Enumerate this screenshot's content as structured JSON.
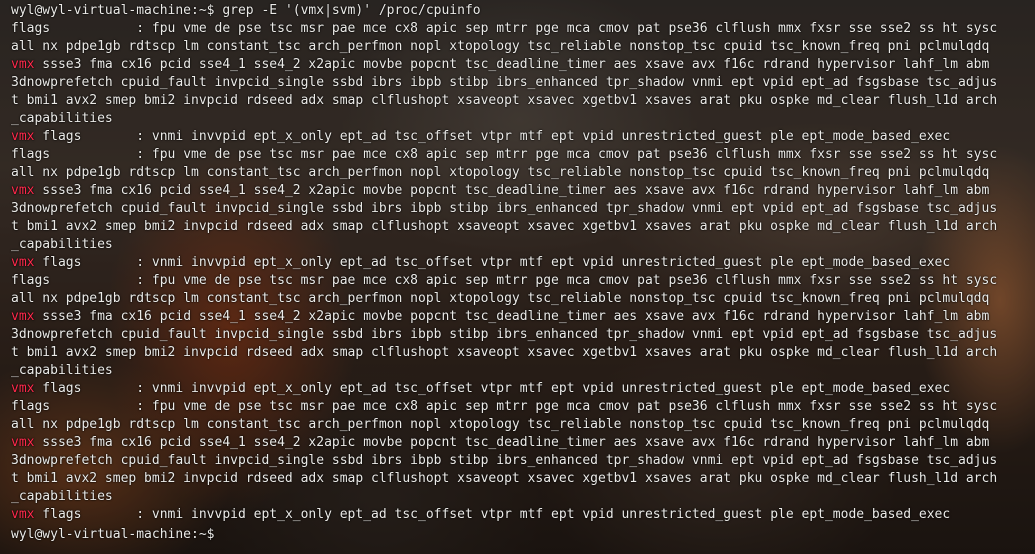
{
  "prompt": "wyl@wyl-virtual-machine:~$",
  "command": " grep -E '(vmx|svm)' /proc/cpuinfo",
  "match_token": "vmx",
  "highlight_color": "#ff2a4c",
  "blocks": [
    {
      "flags_label": "flags",
      "flags_rest": "           : fpu vme de pse tsc msr pae mce cx8 apic sep mtrr pge mca cmov pat pse36 clflush mmx fxsr sse sse2 ss ht sysc",
      "l2": "all nx pdpe1gb rdtscp lm constant_tsc arch_perfmon nopl xtopology tsc_reliable nonstop_tsc cpuid tsc_known_freq pni pclmulqdq",
      "l3_rest": " ssse3 fma cx16 pcid sse4_1 sse4_2 x2apic movbe popcnt tsc_deadline_timer aes xsave avx f16c rdrand hypervisor lahf_lm abm",
      "l4": "3dnowprefetch cpuid_fault invpcid_single ssbd ibrs ibpb stibp ibrs_enhanced tpr_shadow vnmi ept vpid ept_ad fsgsbase tsc_adjus",
      "l5": "t bmi1 avx2 smep bmi2 invpcid rdseed adx smap clflushopt xsaveopt xsavec xgetbv1 xsaves arat pku ospke md_clear flush_l1d arch",
      "l6": "_capabilities",
      "vmx_rest": " flags       : vnmi invvpid ept_x_only ept_ad tsc_offset vtpr mtf ept vpid unrestricted_guest ple ept_mode_based_exec"
    },
    {
      "flags_label": "flags",
      "flags_rest": "           : fpu vme de pse tsc msr pae mce cx8 apic sep mtrr pge mca cmov pat pse36 clflush mmx fxsr sse sse2 ss ht sysc",
      "l2": "all nx pdpe1gb rdtscp lm constant_tsc arch_perfmon nopl xtopology tsc_reliable nonstop_tsc cpuid tsc_known_freq pni pclmulqdq",
      "l3_rest": " ssse3 fma cx16 pcid sse4_1 sse4_2 x2apic movbe popcnt tsc_deadline_timer aes xsave avx f16c rdrand hypervisor lahf_lm abm",
      "l4": "3dnowprefetch cpuid_fault invpcid_single ssbd ibrs ibpb stibp ibrs_enhanced tpr_shadow vnmi ept vpid ept_ad fsgsbase tsc_adjus",
      "l5": "t bmi1 avx2 smep bmi2 invpcid rdseed adx smap clflushopt xsaveopt xsavec xgetbv1 xsaves arat pku ospke md_clear flush_l1d arch",
      "l6": "_capabilities",
      "vmx_rest": " flags       : vnmi invvpid ept_x_only ept_ad tsc_offset vtpr mtf ept vpid unrestricted_guest ple ept_mode_based_exec"
    },
    {
      "flags_label": "flags",
      "flags_rest": "           : fpu vme de pse tsc msr pae mce cx8 apic sep mtrr pge mca cmov pat pse36 clflush mmx fxsr sse sse2 ss ht sysc",
      "l2": "all nx pdpe1gb rdtscp lm constant_tsc arch_perfmon nopl xtopology tsc_reliable nonstop_tsc cpuid tsc_known_freq pni pclmulqdq",
      "l3_rest": " ssse3 fma cx16 pcid sse4_1 sse4_2 x2apic movbe popcnt tsc_deadline_timer aes xsave avx f16c rdrand hypervisor lahf_lm abm",
      "l4": "3dnowprefetch cpuid_fault invpcid_single ssbd ibrs ibpb stibp ibrs_enhanced tpr_shadow vnmi ept vpid ept_ad fsgsbase tsc_adjus",
      "l5": "t bmi1 avx2 smep bmi2 invpcid rdseed adx smap clflushopt xsaveopt xsavec xgetbv1 xsaves arat pku ospke md_clear flush_l1d arch",
      "l6": "_capabilities",
      "vmx_rest": " flags       : vnmi invvpid ept_x_only ept_ad tsc_offset vtpr mtf ept vpid unrestricted_guest ple ept_mode_based_exec"
    },
    {
      "flags_label": "flags",
      "flags_rest": "           : fpu vme de pse tsc msr pae mce cx8 apic sep mtrr pge mca cmov pat pse36 clflush mmx fxsr sse sse2 ss ht sysc",
      "l2": "all nx pdpe1gb rdtscp lm constant_tsc arch_perfmon nopl xtopology tsc_reliable nonstop_tsc cpuid tsc_known_freq pni pclmulqdq",
      "l3_rest": " ssse3 fma cx16 pcid sse4_1 sse4_2 x2apic movbe popcnt tsc_deadline_timer aes xsave avx f16c rdrand hypervisor lahf_lm abm",
      "l4": "3dnowprefetch cpuid_fault invpcid_single ssbd ibrs ibpb stibp ibrs_enhanced tpr_shadow vnmi ept vpid ept_ad fsgsbase tsc_adjus",
      "l5": "t bmi1 avx2 smep bmi2 invpcid rdseed adx smap clflushopt xsaveopt xsavec xgetbv1 xsaves arat pku ospke md_clear flush_l1d arch",
      "l6": "_capabilities",
      "vmx_rest": " flags       : vnmi invvpid ept_x_only ept_ad tsc_offset vtpr mtf ept vpid unrestricted_guest ple ept_mode_based_exec"
    }
  ]
}
